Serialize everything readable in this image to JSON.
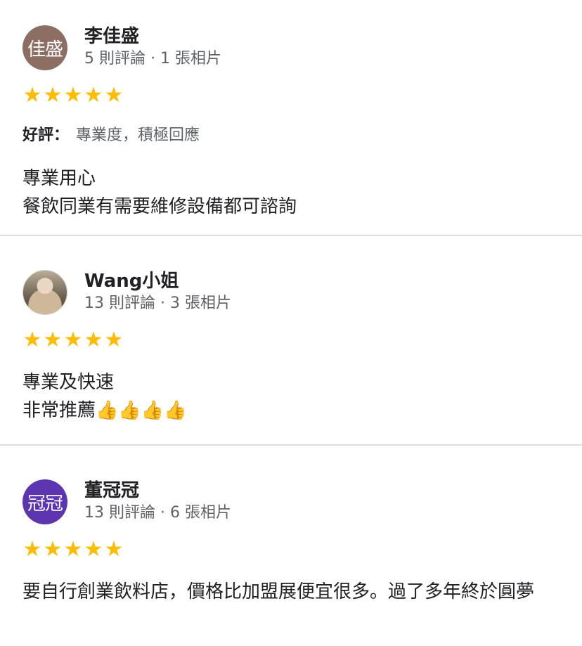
{
  "reviews": [
    {
      "name": "李佳盛",
      "avatar_text": "佳盛",
      "avatar_color": "#8d6e63",
      "stats": "5 則評論 · 1 張相片",
      "stars": [
        "★",
        "★",
        "★",
        "★",
        "★"
      ],
      "highlight_label": "好評：",
      "highlight_text": "專業度，積極回應",
      "lines": [
        "專業用心",
        "餐飲同業有需要維修設備都可諮詢"
      ]
    },
    {
      "name": "Wang小姐",
      "avatar_text": "",
      "stats": "13 則評論 · 3 張相片",
      "stars": [
        "★",
        "★",
        "★",
        "★",
        "★"
      ],
      "lines": [
        "專業及快速",
        "非常推薦👍👍👍👍"
      ]
    },
    {
      "name": "董冠冠",
      "avatar_text": "冠冠",
      "avatar_color": "#5e35b1",
      "stats": "13 則評論 · 6 張相片",
      "stars": [
        "★",
        "★",
        "★",
        "★",
        "★"
      ],
      "lines": [
        "要自行創業飲料店，價格比加盟展便宜很多。過了多年終於圓夢"
      ]
    }
  ],
  "colors": {
    "star": "#fbbc04",
    "divider": "#dadce0",
    "secondary_text": "#5f6368"
  }
}
